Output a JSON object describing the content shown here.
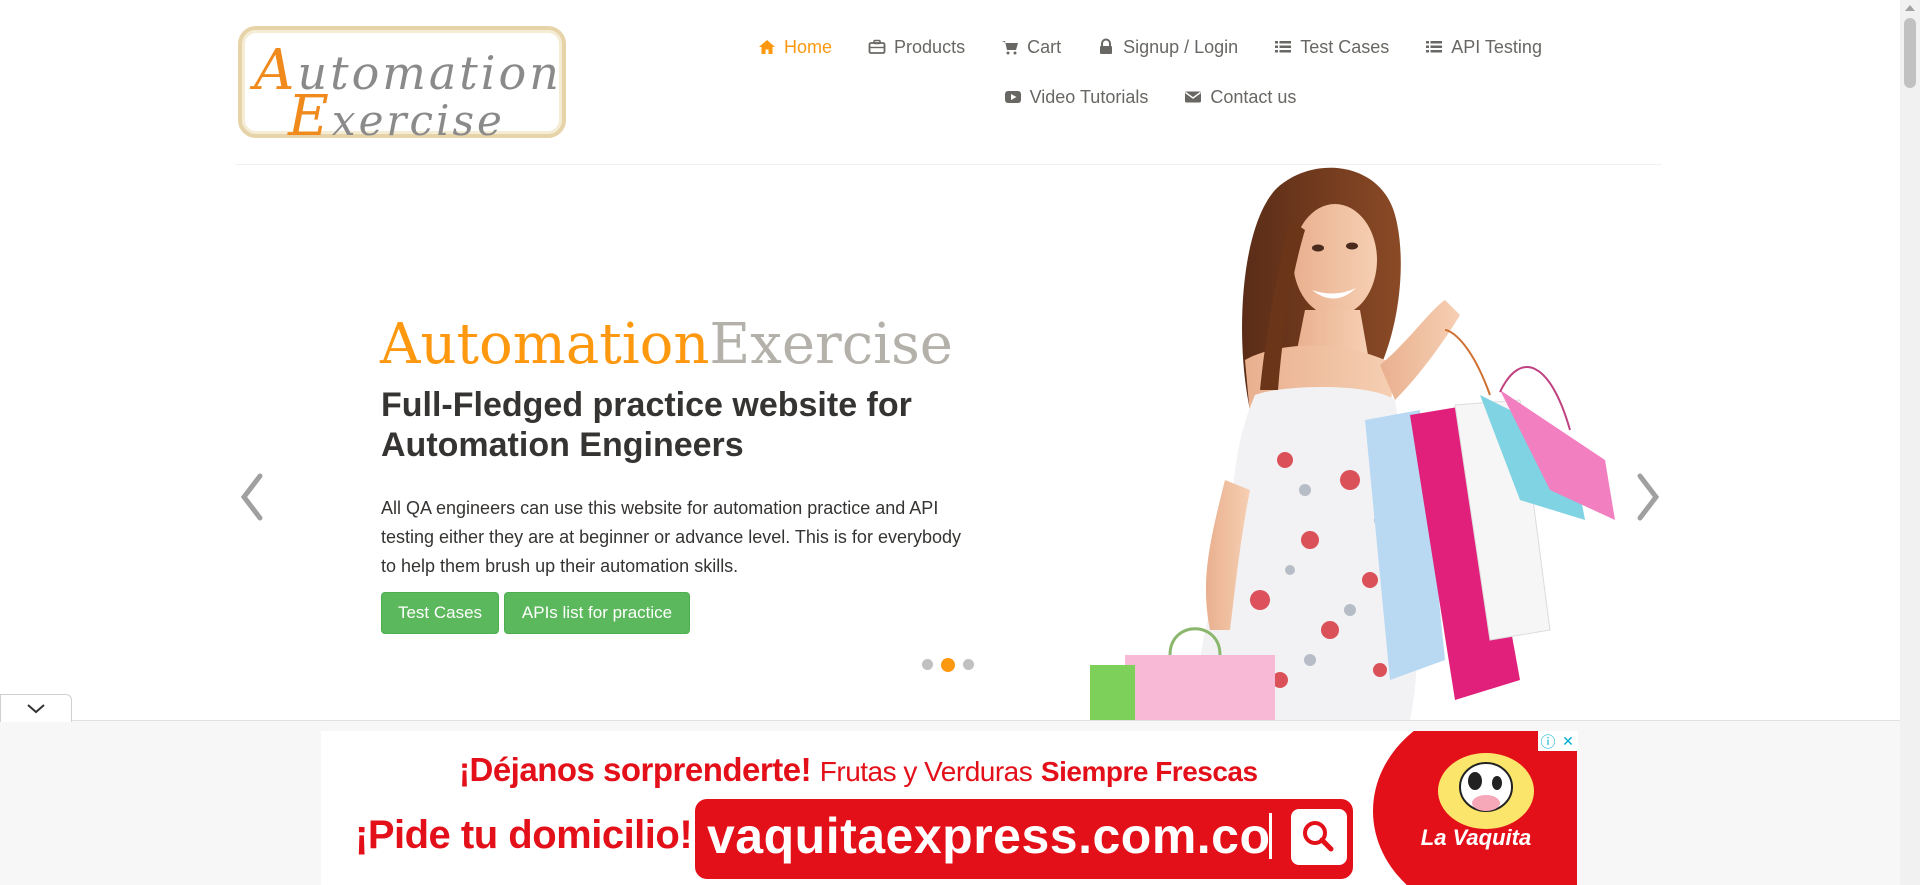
{
  "logo": {
    "line1_cap": "A",
    "line1_rest": "utomation",
    "line2_cap": "E",
    "line2_rest": "xercise"
  },
  "nav": {
    "items": [
      {
        "label": "Home",
        "icon": "home-icon",
        "active": true
      },
      {
        "label": "Products",
        "icon": "briefcase-icon"
      },
      {
        "label": "Cart",
        "icon": "shopping-cart-icon"
      },
      {
        "label": "Signup / Login",
        "icon": "lock-icon"
      },
      {
        "label": "Test Cases",
        "icon": "list-icon"
      },
      {
        "label": "API Testing",
        "icon": "list-icon"
      },
      {
        "label": "Video Tutorials",
        "icon": "youtube-play-icon"
      },
      {
        "label": "Contact us",
        "icon": "envelope-icon"
      }
    ]
  },
  "slider": {
    "brand_a": "Automation",
    "brand_b": "Exercise",
    "title": "Full-Fledged practice website for Automation Engineers",
    "text": "All QA engineers can use this website for automation practice and API testing either they are at beginner or advance level. This is for everybody to help them brush up their automation skills.",
    "buttons": {
      "test_cases": "Test Cases",
      "apis": "APIs list for practice"
    },
    "dots": 3,
    "active_dot": 2
  },
  "ad": {
    "line1_bold": "¡Déjanos sorprenderte!",
    "line1_normal": "Frutas y Verduras",
    "line1_bold2": "Siempre Frescas",
    "line2": "¡Pide tu domicilio!",
    "url": "vaquitaexpress.com.co",
    "brand": "La Vaquita",
    "info_glyph": "ⓘ",
    "close_glyph": "✕"
  },
  "colors": {
    "accent": "#fe980f",
    "nav_text": "#696763",
    "button_green": "#5cb85c",
    "ad_red": "#e3101a"
  }
}
